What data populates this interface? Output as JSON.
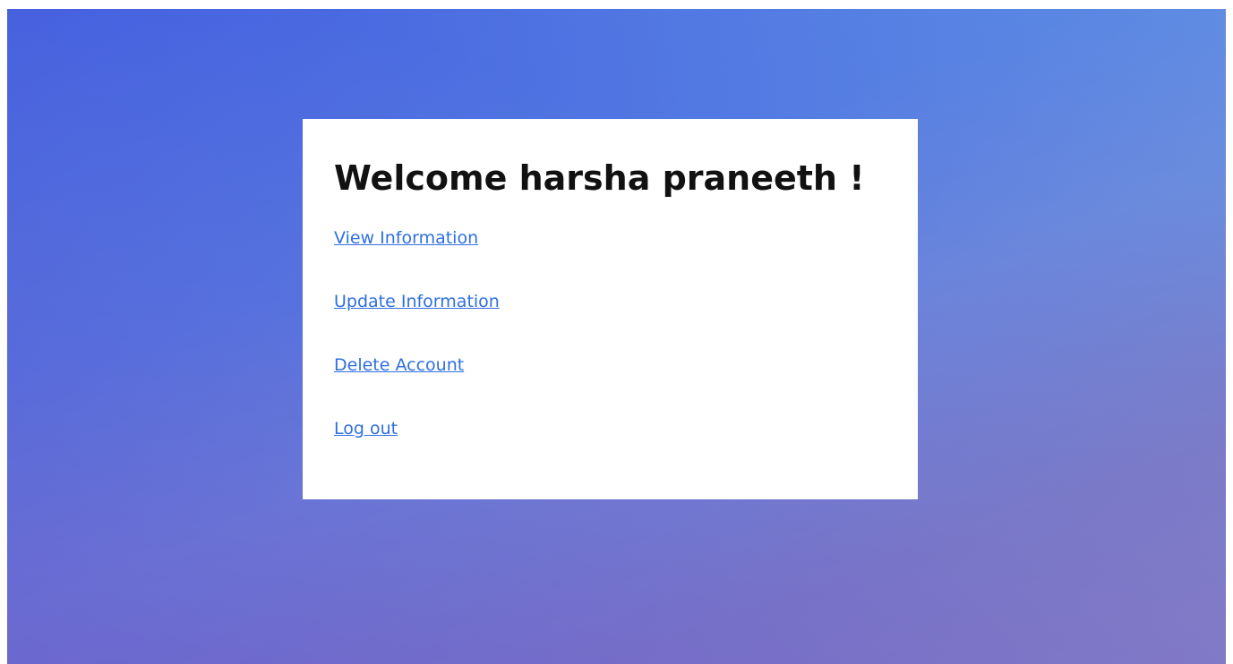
{
  "colors": {
    "link": "#2f6fe0",
    "heading": "#111111",
    "card_background": "#ffffff",
    "gradient_start": "#4562e0",
    "gradient_end": "#8783c6"
  },
  "card": {
    "title": "Welcome harsha praneeth !",
    "links": [
      {
        "label": "View Information"
      },
      {
        "label": "Update Information"
      },
      {
        "label": "Delete Account"
      },
      {
        "label": "Log out"
      }
    ]
  }
}
